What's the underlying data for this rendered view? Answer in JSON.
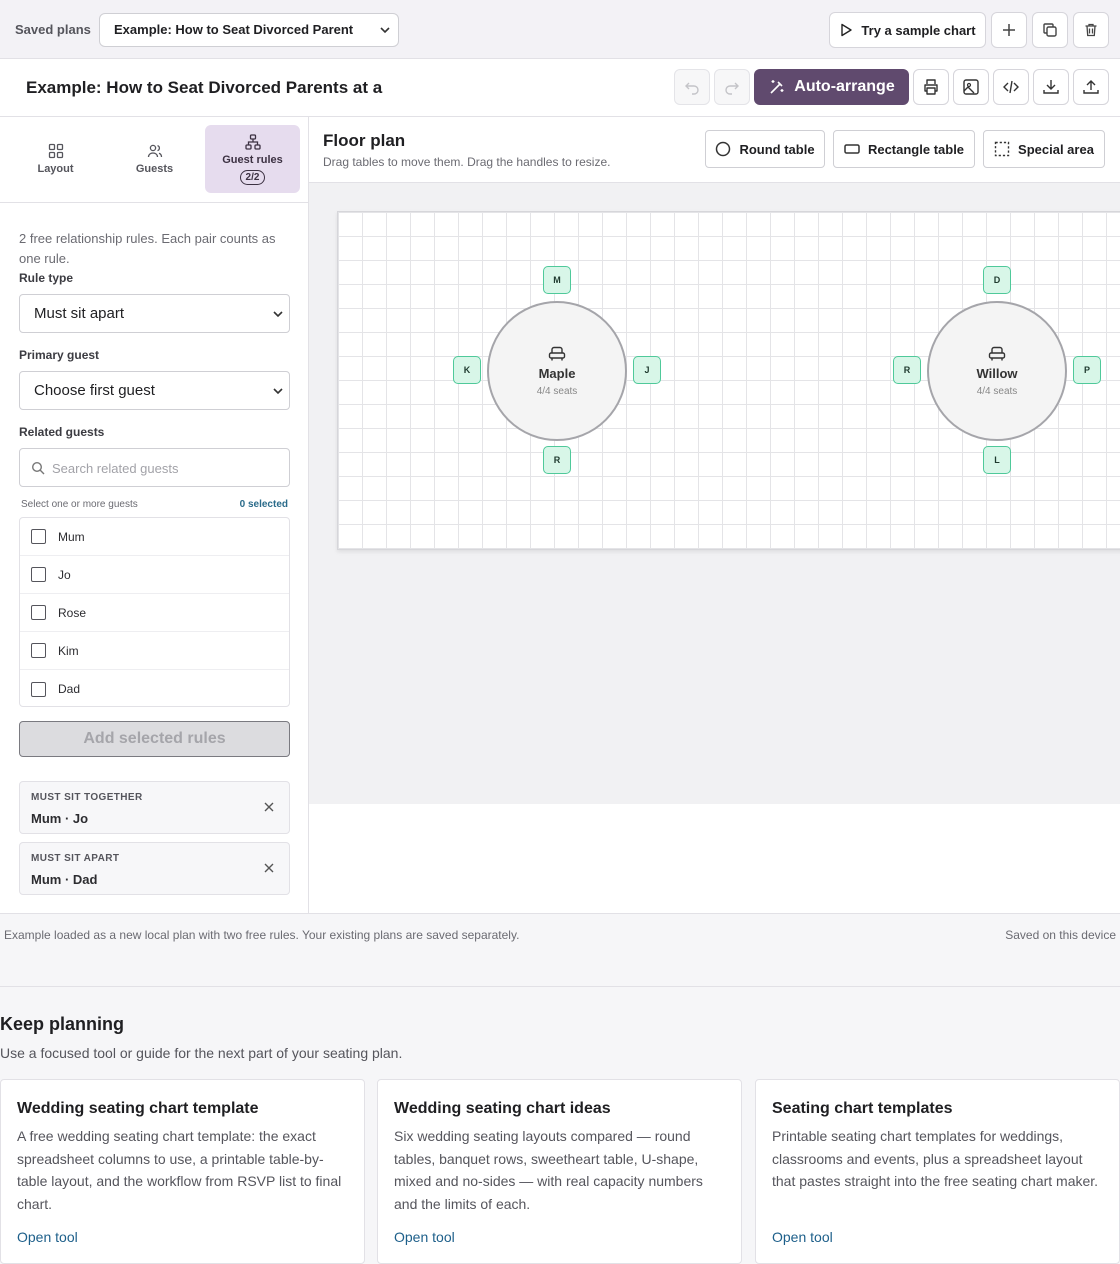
{
  "topbar": {
    "saved_label": "Saved plans",
    "plan_select_value": "Example: How to Seat Divorced Parent",
    "sample_button": "Try a sample chart"
  },
  "titlebar": {
    "plan_title": "Example: How to Seat Divorced Parents at a",
    "auto_arrange": "Auto-arrange"
  },
  "tabs": [
    {
      "label": "Layout",
      "icon": "grid-icon"
    },
    {
      "label": "Guests",
      "icon": "users-icon"
    },
    {
      "label": "Guest rules",
      "icon": "hierarchy-icon",
      "badge": "2/2"
    }
  ],
  "rules_panel": {
    "intro": "2 free relationship rules. Each pair counts as one rule.",
    "rule_type_label": "Rule type",
    "rule_type_value": "Must sit apart",
    "primary_label": "Primary guest",
    "primary_value": "Choose first guest",
    "related_label": "Related guests",
    "search_placeholder": "Search related guests",
    "select_hint": "Select one or more guests",
    "selected_count": "0 selected",
    "guests": [
      "Mum",
      "Jo",
      "Rose",
      "Kim",
      "Dad"
    ],
    "add_button": "Add selected rules",
    "rules": [
      {
        "type": "MUST SIT TOGETHER",
        "names": "Mum · Jo"
      },
      {
        "type": "MUST SIT APART",
        "names": "Mum · Dad"
      }
    ]
  },
  "floorplan": {
    "title": "Floor plan",
    "subtitle": "Drag tables to move them. Drag the handles to resize.",
    "round_table": "Round table",
    "rect_table": "Rectangle table",
    "special_area": "Special area",
    "tables": [
      {
        "name": "Maple",
        "seats": "4/4 seats",
        "top": "M",
        "left": "K",
        "right": "J",
        "bottom": "R"
      },
      {
        "name": "Willow",
        "seats": "4/4 seats",
        "top": "D",
        "left": "R",
        "right": "P",
        "bottom": "L"
      }
    ]
  },
  "status": {
    "left": "Example loaded as a new local plan with two free rules. Your existing plans are saved separately.",
    "right": "Saved on this device"
  },
  "keep_planning": {
    "title": "Keep planning",
    "subtitle": "Use a focused tool or guide for the next part of your seating plan.",
    "cards": [
      {
        "title": "Wedding seating chart template",
        "desc": "A free wedding seating chart template: the exact spreadsheet columns to use, a printable table-by-table layout, and the workflow from RSVP list to final chart.",
        "link": "Open tool"
      },
      {
        "title": "Wedding seating chart ideas",
        "desc": "Six wedding seating layouts compared — round tables, banquet rows, sweetheart table, U-shape, mixed and no-sides — with real capacity numbers and the limits of each.",
        "link": "Open tool"
      },
      {
        "title": "Seating chart templates",
        "desc": "Printable seating chart templates for weddings, classrooms and events, plus a spreadsheet layout that pastes straight into the free seating chart maker.",
        "link": "Open tool"
      }
    ]
  },
  "colors": {
    "accent": "#604a6e",
    "tab_active_bg": "#e6dcee",
    "seat_fill": "#d8f6e8",
    "seat_border": "#4fc99a",
    "link": "#1d5f8a"
  }
}
